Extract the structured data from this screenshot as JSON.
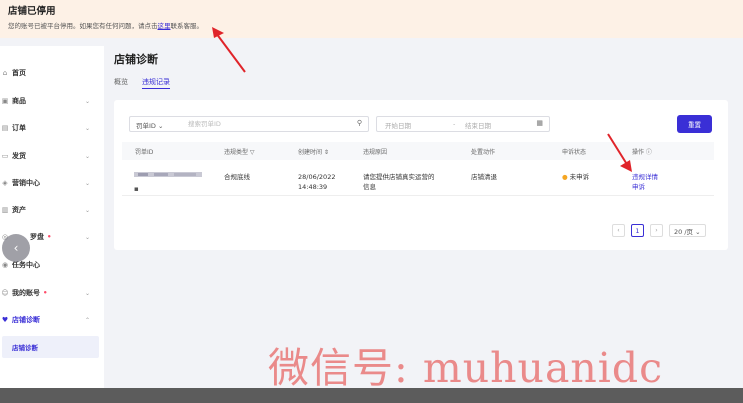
{
  "banner": {
    "title": "店铺已停用",
    "msg_prefix": "您的账号已被平台停用。如果您有任何问题，请点击",
    "link": "这里",
    "msg_suffix": "联系客服。"
  },
  "sidebar": {
    "items": [
      {
        "icon": "⌂",
        "label": "首页",
        "chev": ""
      },
      {
        "icon": "▣",
        "label": "商品",
        "chev": "⌄"
      },
      {
        "icon": "▤",
        "label": "订单",
        "chev": "⌄"
      },
      {
        "icon": "▭",
        "label": "发货",
        "chev": "⌄"
      },
      {
        "icon": "◈",
        "label": "营销中心",
        "chev": "⌄"
      },
      {
        "icon": "▥",
        "label": "资产",
        "chev": "⌄"
      },
      {
        "icon": "◎",
        "label": "罗盘",
        "chev": "⌄",
        "dot": "•"
      },
      {
        "icon": "◉",
        "label": "任务中心",
        "chev": ""
      },
      {
        "icon": "☺",
        "label": "我的账号",
        "chev": "⌄",
        "dot": "•"
      },
      {
        "icon": "♥",
        "label": "店铺诊断",
        "chev": "⌃"
      }
    ],
    "sub_item": "店铺诊断",
    "collapse_glyph": "‹"
  },
  "main": {
    "title": "店铺诊断",
    "tabs": [
      {
        "label": "概览",
        "active": false
      },
      {
        "label": "违规记录",
        "active": true
      }
    ]
  },
  "filters": {
    "select_label": "罚单ID",
    "select_chev": "⌄",
    "search_placeholder": "搜索罚单ID",
    "search_icon": "⚲",
    "start_date": "开始日期",
    "date_sep": "-",
    "end_date": "结束日期",
    "calendar_icon": "▦",
    "reset_label": "重置"
  },
  "table": {
    "headers": [
      "罚单ID",
      "违规类型 ▽",
      "创建时间 ⇕",
      "违规原因",
      "处置动作",
      "申诉状态",
      "操作 ⓘ"
    ],
    "row": {
      "id": "▪",
      "type": "合规底线",
      "date": "28/06/2022",
      "time": "14:48:39",
      "reason_l1": "请您提供店铺真实运营的",
      "reason_l2": "信息",
      "action": "店铺清退",
      "status": "未申诉",
      "op1": "违规详情",
      "op2": "申诉"
    }
  },
  "pagination": {
    "prev": "‹",
    "current": "1",
    "next": "›",
    "page_size": "20 /页 ⌄"
  },
  "watermark": "微信号: muhuanidc",
  "colors": {
    "accent": "#3a2fd6",
    "banner_bg": "#fdf1e6",
    "arrow": "#e0242a",
    "watermark": "#ea8a8a"
  }
}
